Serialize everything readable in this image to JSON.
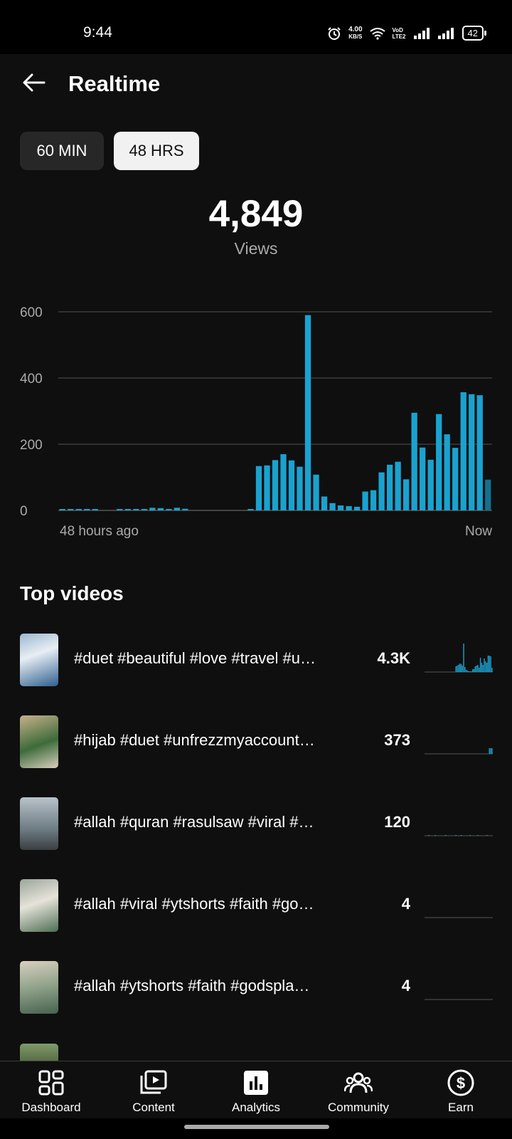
{
  "status_bar": {
    "time": "9:44",
    "net_speed_value": "4.00",
    "net_speed_unit": "KB/S",
    "volte": "VoD LTE2",
    "battery": "42",
    "icons": [
      "alarm-icon",
      "wifi-icon",
      "signal-icon",
      "signal-icon",
      "battery-icon"
    ]
  },
  "header": {
    "title": "Realtime",
    "back_icon": "arrow-left-icon"
  },
  "filters": {
    "option_1": "60 MIN",
    "option_2": "48 HRS",
    "selected": "48 HRS"
  },
  "summary": {
    "total": "4,849",
    "label": "Views"
  },
  "chart_data": {
    "type": "bar",
    "x_start_label": "48 hours ago",
    "x_end_label": "Now",
    "ylim": [
      0,
      600
    ],
    "yticks": [
      "0",
      "200",
      "400",
      "600"
    ],
    "grid": true,
    "color": "#1aa2cf",
    "values": [
      2,
      1,
      1,
      1,
      1,
      0,
      0,
      1,
      1,
      2,
      2,
      8,
      7,
      2,
      8,
      5,
      0,
      0,
      0,
      0,
      0,
      0,
      0,
      2,
      134,
      136,
      152,
      170,
      151,
      132,
      590,
      108,
      42,
      22,
      15,
      13,
      11,
      57,
      61,
      115,
      138,
      147,
      94,
      295,
      190,
      153,
      291,
      230,
      189,
      357,
      351,
      348,
      93
    ]
  },
  "top_videos": {
    "title": "Top videos",
    "items": [
      {
        "title": "#duet #beautiful #love #travel #u…",
        "views": "4.3K",
        "trend": [
          0,
          0,
          0,
          0,
          0,
          0,
          0,
          0,
          0,
          0,
          0,
          0,
          0,
          0,
          0,
          0,
          0,
          0,
          0,
          0,
          0,
          0,
          0,
          0,
          8,
          9,
          10,
          12,
          11,
          9,
          45,
          7,
          3,
          2,
          1,
          1,
          1,
          4,
          4,
          8,
          9,
          10,
          6,
          20,
          13,
          10,
          19,
          15,
          13,
          23,
          23,
          22,
          6
        ]
      },
      {
        "title": "#hijab #duet #unfrezzmyaccount…",
        "views": "373",
        "trend": [
          0,
          0,
          0,
          0,
          0,
          0,
          0,
          0,
          0,
          0,
          0,
          0,
          0,
          0,
          0,
          0,
          0,
          0,
          0,
          0,
          0,
          0,
          0,
          0,
          0,
          0,
          0,
          0,
          0,
          0,
          0,
          0,
          0,
          0,
          0,
          0,
          0,
          0,
          0,
          0,
          0,
          0,
          0,
          0,
          0,
          0,
          0,
          0,
          0,
          0,
          8,
          8,
          8
        ]
      },
      {
        "title": "#allah #quran #rasulsaw #viral #…",
        "views": "120",
        "trend": [
          0,
          0,
          0,
          1,
          0,
          0,
          0,
          0,
          1,
          0,
          0,
          0,
          0,
          0,
          0,
          0,
          1,
          0,
          0,
          0,
          0,
          0,
          0,
          0,
          1,
          0,
          0,
          0,
          1,
          0,
          0,
          0,
          0,
          0,
          0,
          1,
          0,
          0,
          0,
          0,
          0,
          1,
          0,
          0,
          0,
          0,
          0,
          0,
          1,
          0,
          0,
          0,
          0
        ]
      },
      {
        "title": "#allah #viral #ytshorts #faith #go…",
        "views": "4",
        "trend": [
          0,
          0,
          0,
          0,
          0,
          0,
          0,
          0,
          0,
          0,
          0,
          0,
          0,
          0,
          0,
          0,
          0,
          0,
          0,
          0,
          0,
          0,
          0,
          0,
          0,
          0,
          0,
          0,
          0,
          0,
          0,
          0,
          0,
          0,
          0,
          0,
          0,
          0,
          0,
          0,
          0,
          0,
          0,
          0,
          0,
          0,
          0,
          0,
          0,
          0,
          0,
          0,
          0
        ]
      },
      {
        "title": "#allah #ytshorts #faith #godspla…",
        "views": "4",
        "trend": [
          0,
          0,
          0,
          0,
          0,
          0,
          0,
          0,
          0,
          0,
          0,
          0,
          0,
          0,
          0,
          0,
          0,
          0,
          0,
          0,
          0,
          0,
          0,
          0,
          0,
          0,
          0,
          0,
          0,
          0,
          0,
          0,
          0,
          0,
          0,
          0,
          0,
          0,
          0,
          0,
          0,
          0,
          0,
          0,
          0,
          0,
          0,
          0,
          0,
          0,
          0,
          0,
          0
        ]
      }
    ]
  },
  "bottom_nav": {
    "items": [
      {
        "label": "Dashboard",
        "icon": "dashboard-icon"
      },
      {
        "label": "Content",
        "icon": "content-icon"
      },
      {
        "label": "Analytics",
        "icon": "analytics-icon",
        "active": true
      },
      {
        "label": "Community",
        "icon": "community-icon"
      },
      {
        "label": "Earn",
        "icon": "earn-icon"
      }
    ]
  }
}
